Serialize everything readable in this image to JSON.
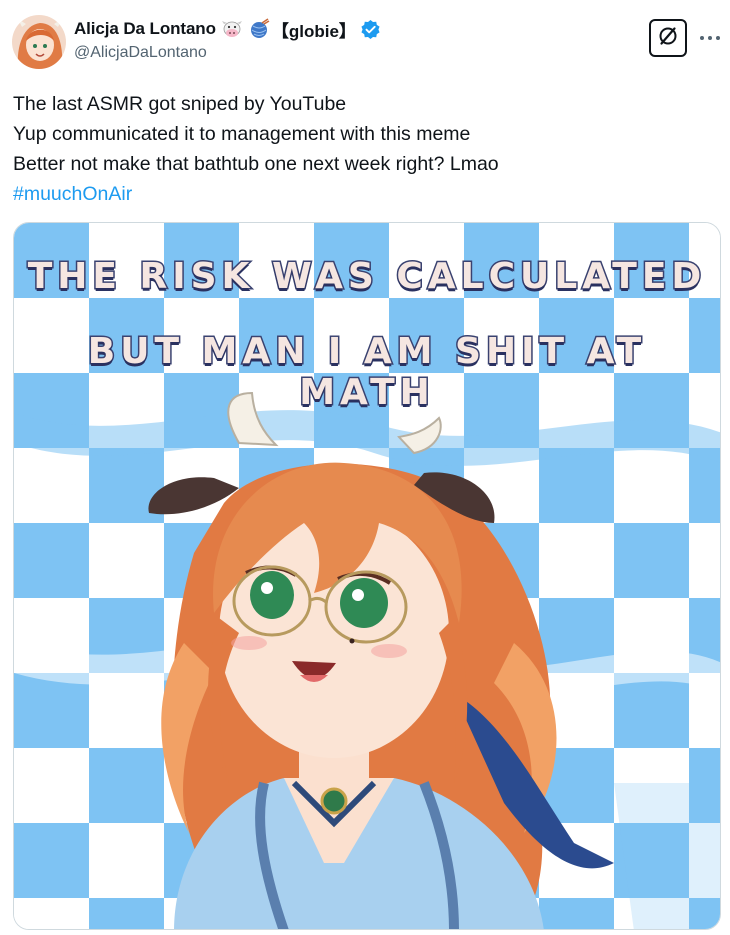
{
  "author": {
    "display_name": "Alicja Da Lontano",
    "name_tag": "【globie】",
    "handle": "@AlicjaDaLontano",
    "emoji_1": "cow-face-icon",
    "emoji_2": "yarn-ball-icon",
    "verified_color": "#1d9bf0"
  },
  "actions": {
    "grok": "grok-icon",
    "more": "more-icon"
  },
  "tweet": {
    "lines": [
      "The last ASMR got sniped by YouTube",
      "Yup communicated it to management with this meme",
      "Better not make that bathtub one next week right? Lmao"
    ],
    "hashtag": "#muuchOnAir"
  },
  "media": {
    "caption_line_1": "THE RISK WAS CALCULATED",
    "caption_line_2": "BUT MAN I AM SHIT AT MATH",
    "background": "blue-white-checkered",
    "colors": {
      "checker_blue": "#7ec3f3",
      "caption_fill": "#f5e6e1",
      "caption_outline": "#3a4270"
    }
  }
}
